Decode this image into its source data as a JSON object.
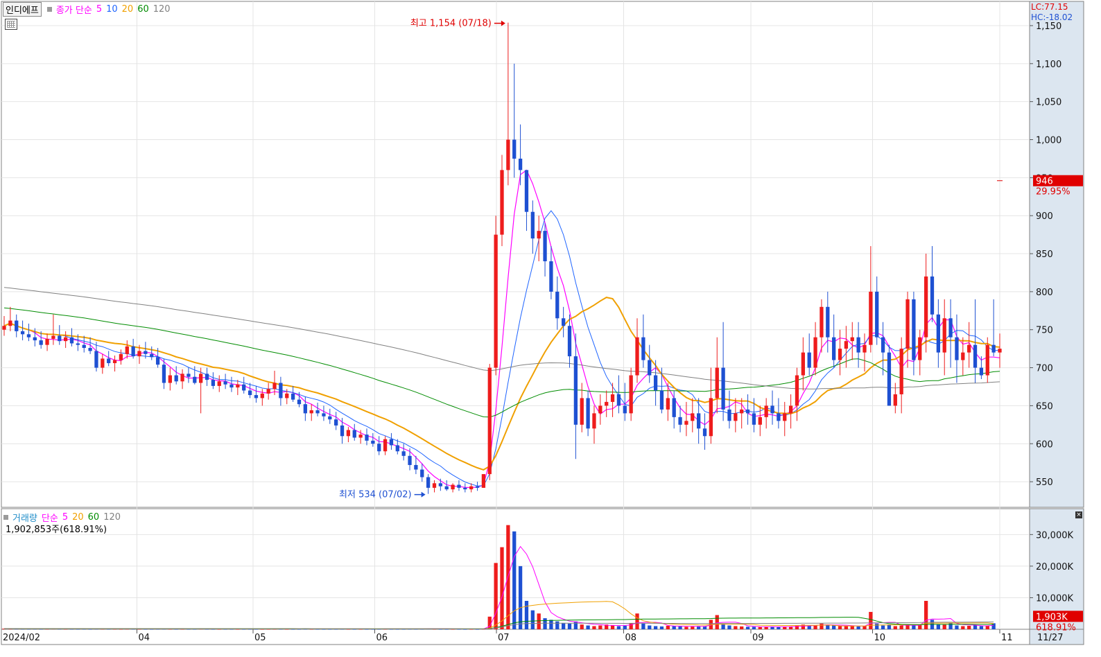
{
  "price_legend": {
    "stock_name": "인디에프",
    "ma_label": "종가 단순",
    "periods": [
      "5",
      "10",
      "20",
      "60",
      "120"
    ],
    "period_colors": [
      "#ff00ff",
      "#1e64ff",
      "#f0a000",
      "#008c00",
      "#808080"
    ],
    "lc_label": "LC:77.15",
    "hc_label": "HC:-18.02"
  },
  "volume_legend": {
    "title": "거래량",
    "ma_label": "단순",
    "periods": [
      "5",
      "20",
      "60",
      "120"
    ],
    "period_colors": [
      "#ff00ff",
      "#f0a000",
      "#008c00",
      "#808080"
    ],
    "current_volume": "1,902,853주(618.91%)"
  },
  "annotations": {
    "high": "최고 1,154 (07/18)",
    "low": "최저 534 (07/02)"
  },
  "price_axis": {
    "ticks": [
      "550",
      "600",
      "650",
      "700",
      "750",
      "800",
      "850",
      "900",
      "950",
      "1,000",
      "1,050",
      "1,100",
      "1,150"
    ],
    "current_price": "946",
    "current_change": "29.95%"
  },
  "volume_axis": {
    "ticks": [
      "10,000K",
      "20,000K",
      "30,000K"
    ],
    "current_volume": "1,903K",
    "current_pct": "618.91%"
  },
  "x_axis": {
    "labels": [
      "2024/02",
      "04",
      "05",
      "06",
      "07",
      "08",
      "09",
      "10",
      "11"
    ],
    "last_date": "11/27"
  },
  "colors": {
    "up": "#ee1c1c",
    "down": "#1e50d2",
    "ma5": "#ff00ff",
    "ma10": "#1e64ff",
    "ma20": "#f0a000",
    "ma60": "#008c00",
    "ma120": "#808080"
  },
  "chart_data": {
    "type": "candlestick",
    "title": "인디에프",
    "ylim": [
      520,
      1160
    ],
    "volume_ylim": [
      0,
      36000
    ],
    "candles": [
      [
        750,
        768,
        742,
        755
      ],
      [
        755,
        780,
        748,
        762
      ],
      [
        762,
        770,
        740,
        748
      ],
      [
        748,
        762,
        736,
        744
      ],
      [
        744,
        758,
        735,
        740
      ],
      [
        740,
        752,
        728,
        736
      ],
      [
        736,
        748,
        725,
        730
      ],
      [
        730,
        745,
        722,
        738
      ],
      [
        738,
        770,
        730,
        742
      ],
      [
        742,
        756,
        730,
        735
      ],
      [
        735,
        748,
        726,
        740
      ],
      [
        740,
        752,
        728,
        732
      ],
      [
        732,
        744,
        722,
        730
      ],
      [
        730,
        742,
        720,
        726
      ],
      [
        726,
        740,
        718,
        722
      ],
      [
        722,
        734,
        695,
        700
      ],
      [
        700,
        718,
        692,
        712
      ],
      [
        712,
        722,
        702,
        706
      ],
      [
        706,
        716,
        695,
        710
      ],
      [
        710,
        724,
        704,
        718
      ],
      [
        718,
        736,
        712,
        728
      ],
      [
        728,
        738,
        712,
        715
      ],
      [
        715,
        730,
        705,
        722
      ],
      [
        722,
        734,
        712,
        718
      ],
      [
        718,
        728,
        710,
        714
      ],
      [
        714,
        726,
        700,
        704
      ],
      [
        704,
        712,
        672,
        680
      ],
      [
        680,
        700,
        670,
        690
      ],
      [
        690,
        702,
        678,
        682
      ],
      [
        682,
        698,
        672,
        692
      ],
      [
        692,
        700,
        680,
        688
      ],
      [
        688,
        702,
        678,
        680
      ],
      [
        680,
        700,
        640,
        692
      ],
      [
        692,
        700,
        676,
        684
      ],
      [
        684,
        694,
        672,
        676
      ],
      [
        676,
        690,
        668,
        682
      ],
      [
        682,
        692,
        672,
        678
      ],
      [
        678,
        688,
        668,
        674
      ],
      [
        674,
        684,
        664,
        678
      ],
      [
        678,
        688,
        666,
        670
      ],
      [
        670,
        680,
        660,
        664
      ],
      [
        664,
        676,
        654,
        660
      ],
      [
        660,
        672,
        650,
        666
      ],
      [
        666,
        680,
        658,
        672
      ],
      [
        672,
        696,
        664,
        680
      ],
      [
        680,
        688,
        650,
        660
      ],
      [
        660,
        672,
        652,
        666
      ],
      [
        666,
        676,
        655,
        658
      ],
      [
        658,
        668,
        648,
        652
      ],
      [
        652,
        662,
        630,
        640
      ],
      [
        640,
        652,
        630,
        644
      ],
      [
        644,
        654,
        636,
        640
      ],
      [
        640,
        650,
        630,
        636
      ],
      [
        636,
        646,
        626,
        632
      ],
      [
        632,
        642,
        618,
        624
      ],
      [
        624,
        634,
        600,
        610
      ],
      [
        610,
        622,
        602,
        618
      ],
      [
        618,
        626,
        604,
        608
      ],
      [
        608,
        618,
        600,
        612
      ],
      [
        612,
        620,
        598,
        604
      ],
      [
        604,
        614,
        596,
        600
      ],
      [
        600,
        610,
        585,
        590
      ],
      [
        590,
        610,
        585,
        606
      ],
      [
        606,
        614,
        592,
        598
      ],
      [
        598,
        606,
        586,
        590
      ],
      [
        590,
        600,
        578,
        584
      ],
      [
        584,
        594,
        565,
        572
      ],
      [
        572,
        584,
        560,
        566
      ],
      [
        566,
        574,
        550,
        556
      ],
      [
        556,
        560,
        534,
        542
      ],
      [
        542,
        552,
        536,
        548
      ],
      [
        548,
        554,
        538,
        544
      ],
      [
        544,
        552,
        538,
        540
      ],
      [
        540,
        548,
        536,
        546
      ],
      [
        546,
        552,
        538,
        542
      ],
      [
        542,
        548,
        536,
        540
      ],
      [
        540,
        548,
        536,
        544
      ],
      [
        544,
        550,
        538,
        542
      ],
      [
        542,
        552,
        560,
        560
      ],
      [
        560,
        705,
        552,
        700
      ],
      [
        700,
        900,
        690,
        875
      ],
      [
        875,
        980,
        860,
        960
      ],
      [
        960,
        1154,
        940,
        1000
      ],
      [
        1000,
        1100,
        950,
        975
      ],
      [
        975,
        1020,
        940,
        960
      ],
      [
        960,
        950,
        880,
        905
      ],
      [
        905,
        920,
        850,
        870
      ],
      [
        870,
        900,
        840,
        880
      ],
      [
        880,
        890,
        820,
        840
      ],
      [
        840,
        860,
        790,
        800
      ],
      [
        800,
        820,
        750,
        765
      ],
      [
        765,
        780,
        740,
        755
      ],
      [
        755,
        770,
        700,
        715
      ],
      [
        715,
        745,
        580,
        625
      ],
      [
        625,
        680,
        615,
        660
      ],
      [
        660,
        670,
        610,
        620
      ],
      [
        620,
        650,
        600,
        640
      ],
      [
        640,
        665,
        625,
        650
      ],
      [
        650,
        670,
        635,
        655
      ],
      [
        655,
        680,
        635,
        665
      ],
      [
        665,
        690,
        640,
        650
      ],
      [
        650,
        680,
        630,
        640
      ],
      [
        640,
        700,
        630,
        690
      ],
      [
        690,
        765,
        680,
        740
      ],
      [
        740,
        770,
        700,
        710
      ],
      [
        710,
        730,
        680,
        690
      ],
      [
        690,
        710,
        650,
        670
      ],
      [
        670,
        700,
        640,
        645
      ],
      [
        645,
        680,
        630,
        660
      ],
      [
        660,
        670,
        620,
        635
      ],
      [
        635,
        650,
        615,
        625
      ],
      [
        625,
        655,
        610,
        630
      ],
      [
        630,
        660,
        615,
        640
      ],
      [
        640,
        660,
        600,
        620
      ],
      [
        620,
        640,
        592,
        610
      ],
      [
        610,
        700,
        600,
        660
      ],
      [
        660,
        740,
        640,
        700
      ],
      [
        700,
        760,
        630,
        645
      ],
      [
        645,
        670,
        620,
        630
      ],
      [
        630,
        660,
        615,
        640
      ],
      [
        640,
        660,
        620,
        645
      ],
      [
        645,
        665,
        625,
        640
      ],
      [
        640,
        660,
        615,
        625
      ],
      [
        625,
        650,
        610,
        635
      ],
      [
        635,
        660,
        620,
        650
      ],
      [
        650,
        670,
        625,
        640
      ],
      [
        640,
        660,
        620,
        630
      ],
      [
        630,
        655,
        610,
        640
      ],
      [
        640,
        665,
        620,
        650
      ],
      [
        650,
        700,
        630,
        690
      ],
      [
        690,
        740,
        670,
        720
      ],
      [
        720,
        745,
        690,
        700
      ],
      [
        700,
        760,
        690,
        740
      ],
      [
        740,
        790,
        720,
        780
      ],
      [
        780,
        800,
        720,
        740
      ],
      [
        740,
        770,
        700,
        710
      ],
      [
        710,
        750,
        690,
        725
      ],
      [
        725,
        755,
        700,
        735
      ],
      [
        735,
        760,
        710,
        740
      ],
      [
        740,
        760,
        700,
        720
      ],
      [
        720,
        745,
        695,
        730
      ],
      [
        730,
        860,
        720,
        800
      ],
      [
        800,
        820,
        730,
        740
      ],
      [
        740,
        760,
        690,
        720
      ],
      [
        720,
        730,
        660,
        650
      ],
      [
        650,
        680,
        640,
        665
      ],
      [
        665,
        740,
        640,
        725
      ],
      [
        725,
        800,
        700,
        790
      ],
      [
        790,
        800,
        690,
        710
      ],
      [
        710,
        750,
        690,
        740
      ],
      [
        740,
        850,
        720,
        820
      ],
      [
        820,
        860,
        760,
        770
      ],
      [
        770,
        790,
        700,
        720
      ],
      [
        720,
        790,
        690,
        765
      ],
      [
        765,
        790,
        700,
        740
      ],
      [
        740,
        770,
        680,
        710
      ],
      [
        710,
        740,
        690,
        720
      ],
      [
        720,
        760,
        700,
        730
      ],
      [
        730,
        790,
        680,
        700
      ],
      [
        700,
        715,
        685,
        690
      ],
      [
        690,
        740,
        680,
        730
      ],
      [
        730,
        790,
        715,
        720
      ],
      [
        720,
        745,
        700,
        725
      ]
    ],
    "volumes": [
      200,
      180,
      190,
      160,
      150,
      170,
      140,
      150,
      200,
      160,
      150,
      140,
      130,
      150,
      120,
      170,
      160,
      140,
      150,
      130,
      160,
      150,
      140,
      130,
      120,
      150,
      170,
      140,
      130,
      140,
      120,
      130,
      180,
      140,
      130,
      120,
      130,
      120,
      110,
      120,
      130,
      120,
      110,
      120,
      150,
      140,
      120,
      110,
      120,
      150,
      130,
      120,
      110,
      120,
      130,
      150,
      120,
      110,
      120,
      110,
      120,
      140,
      150,
      130,
      120,
      130,
      150,
      140,
      160,
      200,
      150,
      120,
      110,
      120,
      110,
      100,
      110,
      100,
      150,
      4000,
      21000,
      26000,
      33000,
      31000,
      20000,
      9000,
      6000,
      5000,
      3500,
      3000,
      2500,
      2000,
      1800,
      2500,
      1500,
      1200,
      1000,
      1200,
      1500,
      1200,
      1000,
      1100,
      2000,
      5000,
      1800,
      1200,
      1000,
      900,
      1100,
      1000,
      900,
      800,
      900,
      1000,
      900,
      3000,
      4500,
      1600,
      1200,
      1000,
      900,
      800,
      800,
      700,
      800,
      900,
      700,
      800,
      900,
      1200,
      1500,
      1100,
      1300,
      1800,
      1400,
      1200,
      1000,
      1100,
      1000,
      900,
      1000,
      5500,
      1800,
      1200,
      1500,
      1000,
      1200,
      1600,
      1200,
      1300,
      9000,
      3000,
      1500,
      1500,
      2000,
      1200,
      1000,
      1100,
      1300,
      1000,
      1100,
      1902
    ],
    "ma5_start": 0,
    "series": [
      {
        "name": "5",
        "values": []
      },
      {
        "name": "10",
        "values": []
      },
      {
        "name": "20",
        "values": []
      },
      {
        "name": "60",
        "values": []
      },
      {
        "name": "120",
        "values": []
      }
    ]
  }
}
